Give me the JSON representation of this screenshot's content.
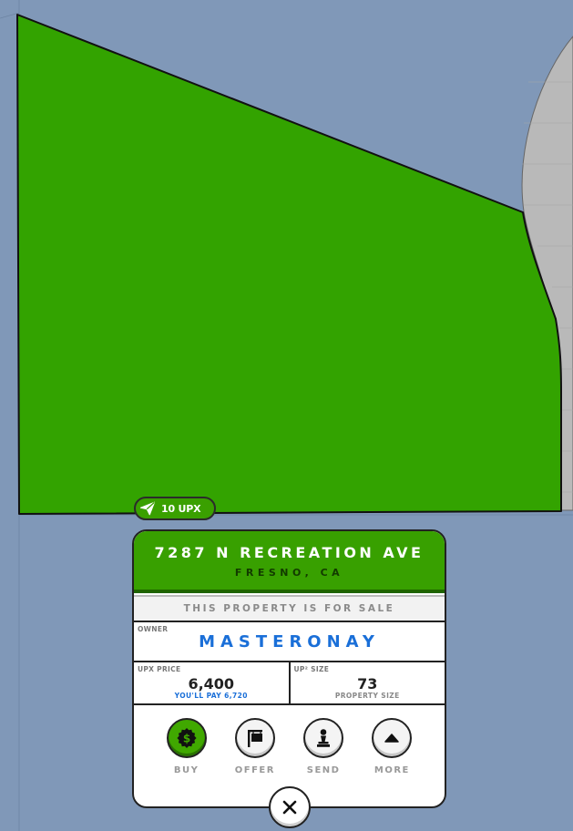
{
  "map": {
    "background_color": "#8098b8",
    "parcel_color": "#33a300",
    "neighbor_color": "#b9b9b9"
  },
  "send_badge": {
    "icon": "paper-plane-icon",
    "label": "10 UPX"
  },
  "property": {
    "address": "7287 N RECREATION AVE",
    "city": "FRESNO, CA",
    "sale_status": "THIS PROPERTY IS FOR SALE",
    "owner_label": "OWNER",
    "owner_name": "MASTERONAY",
    "price_label": "UPX PRICE",
    "price_value": "6,400",
    "price_sub": "YOU'LL PAY 6,720",
    "size_label": "UP² SIZE",
    "size_value": "73",
    "size_sub": "PROPERTY SIZE"
  },
  "actions": [
    {
      "label": "BUY",
      "icon": "dollar-badge-icon"
    },
    {
      "label": "OFFER",
      "icon": "for-sale-sign-icon"
    },
    {
      "label": "SEND",
      "icon": "chess-pawn-icon"
    },
    {
      "label": "MORE",
      "icon": "chevron-up-icon"
    }
  ],
  "close": {
    "icon": "close-icon"
  },
  "colors": {
    "accent_green": "#38a000",
    "header_dark": "#1f6400",
    "owner_blue": "#1a6fd8"
  }
}
